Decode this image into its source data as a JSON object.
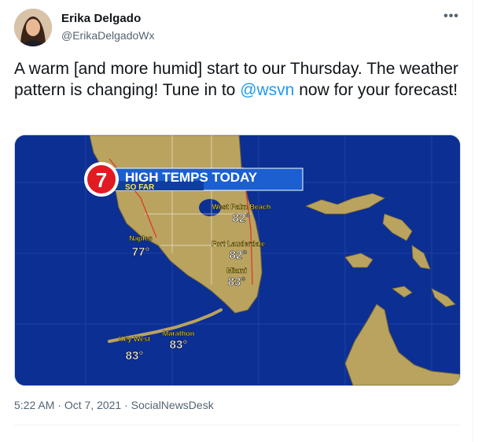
{
  "author": {
    "name": "Erika Delgado",
    "handle": "@ErikaDelgadoWx"
  },
  "tweet": {
    "text_before": "A warm [and more humid] start to our Thursday. The weather pattern is changing!  Tune in to ",
    "mention": "@wsvn",
    "text_after": " now for your forecast!"
  },
  "more_label": "•••",
  "graphic": {
    "logo_number": "7",
    "headline": "HIGH TEMPS TODAY",
    "subheadline": "SO FAR",
    "cities": [
      {
        "name": "West Palm Beach",
        "temp": "82°"
      },
      {
        "name": "Naples",
        "temp": "77°"
      },
      {
        "name": "Fort Lauderdale",
        "temp": "82°"
      },
      {
        "name": "Miami",
        "temp": "83°"
      },
      {
        "name": "Key West",
        "temp": "83°"
      },
      {
        "name": "Marathon",
        "temp": "83°"
      }
    ]
  },
  "meta": {
    "time": "5:22 AM",
    "sep1": " · ",
    "date": "Oct 7, 2021",
    "sep2": " · ",
    "source": "SocialNewsDesk"
  },
  "colors": {
    "ocean": "#0c2f93",
    "land": "#b9a35f",
    "link": "#1d9bf0",
    "city_label": "#ffe14a",
    "banner": "#1b5fd0"
  }
}
